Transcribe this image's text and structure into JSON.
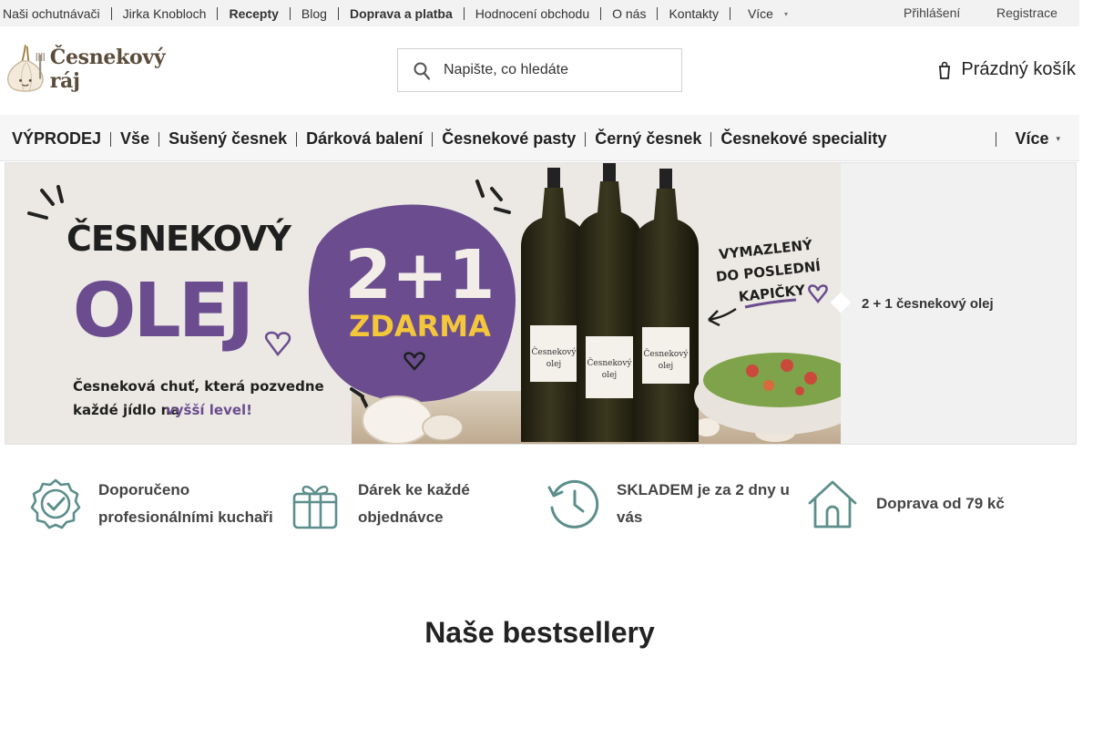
{
  "top_nav": {
    "items": [
      {
        "label": "Naši ochutnávači",
        "bold": false
      },
      {
        "label": "Jirka Knobloch",
        "bold": false
      },
      {
        "label": "Recepty",
        "bold": true
      },
      {
        "label": "Blog",
        "bold": false
      },
      {
        "label": "Doprava a platba",
        "bold": true
      },
      {
        "label": "Hodnocení obchodu",
        "bold": false
      },
      {
        "label": "O nás",
        "bold": false
      },
      {
        "label": "Kontakty",
        "bold": false
      }
    ],
    "more_label": "Více"
  },
  "account": {
    "login": "Přihlášení",
    "register": "Registrace"
  },
  "logo": {
    "text": "Česnekový ráj"
  },
  "search": {
    "placeholder": "Napište, co hledáte",
    "value": ""
  },
  "cart": {
    "label": "Prázdný košík"
  },
  "main_nav": {
    "items": [
      "VÝPRODEJ",
      "Vše",
      "Sušený česnek",
      "Dárková balení",
      "Česnekové pasty",
      "Černý česnek",
      "Česnekové speciality"
    ],
    "more_label": "Více"
  },
  "banner": {
    "headline_1": "ČESNEKOVÝ",
    "headline_2": "OLEJ",
    "tagline_1": "Česneková chuť, která pozvedne",
    "tagline_2": "každé jídlo na",
    "tagline_accent": "vyšší level!",
    "promo_big": "2+1",
    "promo_small": "ZDARMA",
    "handwritten_1": "VYMAZLENÝ",
    "handwritten_2": "DO POSLEDNÍ",
    "handwritten_3": "KAPIČKY",
    "bottle_label_1": "Česnekový",
    "bottle_label_2": "olej",
    "side_label": "2 + 1 česnekový olej",
    "colors": {
      "purple": "#6b4d8f",
      "bg": "#ece9e4",
      "bottle": "#2d2a18"
    }
  },
  "features": [
    {
      "icon": "badge-check-icon",
      "text": "Doporučeno profesionálními kuchaři"
    },
    {
      "icon": "gift-icon",
      "text": "Dárek ke každé objednávce"
    },
    {
      "icon": "clock-icon",
      "text": "SKLADEM je za 2 dny u vás"
    },
    {
      "icon": "house-icon",
      "text": "Doprava od 79 kč"
    }
  ],
  "section": {
    "title": "Naše bestsellery"
  },
  "colors": {
    "accent": "#5c8e8b",
    "topbar_bg": "#f2f2f2",
    "nav_bg": "#f6f6f6"
  }
}
